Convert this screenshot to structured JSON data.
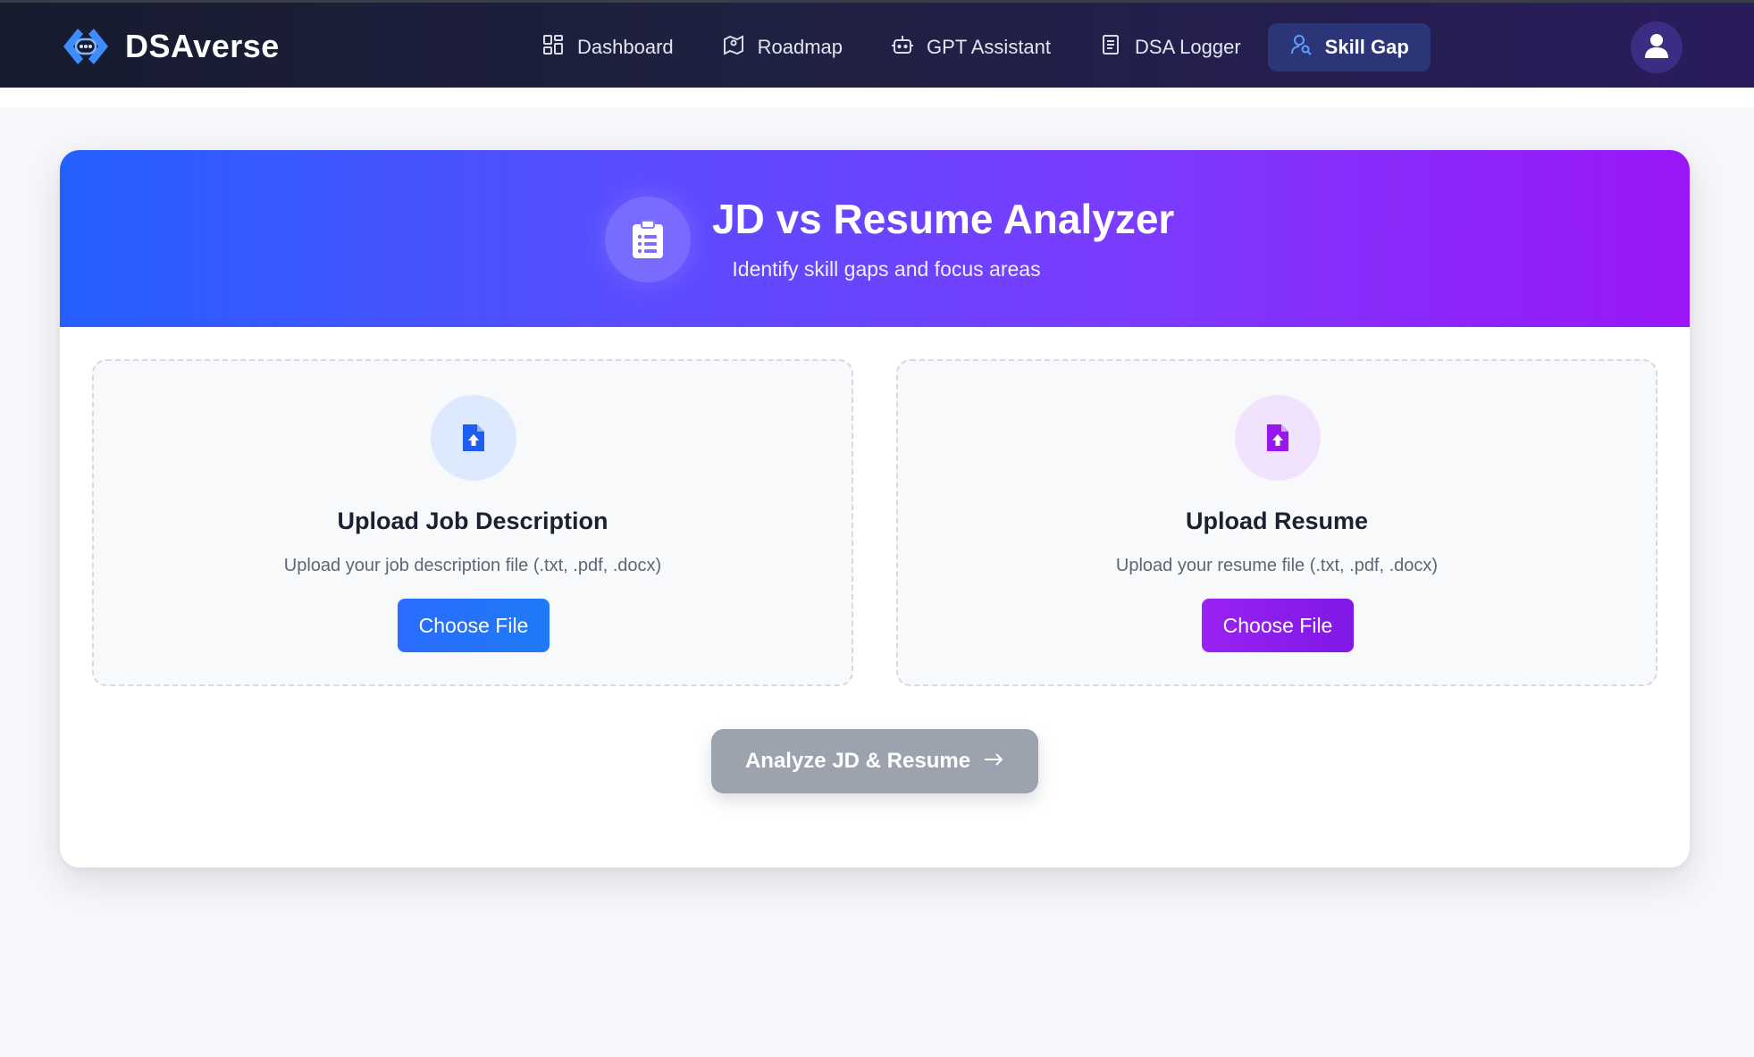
{
  "brand": {
    "name": "DSAverse"
  },
  "nav": {
    "items": [
      {
        "label": "Dashboard",
        "icon": "dashboard-icon"
      },
      {
        "label": "Roadmap",
        "icon": "map-icon"
      },
      {
        "label": "GPT Assistant",
        "icon": "robot-icon"
      },
      {
        "label": "DSA Logger",
        "icon": "document-icon"
      },
      {
        "label": "Skill Gap",
        "icon": "user-search-icon",
        "active": true
      }
    ]
  },
  "hero": {
    "title": "JD vs Resume Analyzer",
    "subtitle": "Identify skill gaps and focus areas",
    "icon": "clipboard-list-icon"
  },
  "uploads": {
    "jd": {
      "title": "Upload Job Description",
      "description": "Upload your job description file (.txt, .pdf, .docx)",
      "button": "Choose File",
      "icon": "file-upload-icon",
      "accent": "#1f63f2"
    },
    "resume": {
      "title": "Upload Resume",
      "description": "Upload your resume file (.txt, .pdf, .docx)",
      "button": "Choose File",
      "icon": "file-upload-icon",
      "accent": "#9a16f0"
    }
  },
  "actions": {
    "analyze": "Analyze JD & Resume"
  },
  "colors": {
    "nav_bg_start": "#171b2e",
    "nav_bg_end": "#2a1c5c",
    "hero_start": "#2460ff",
    "hero_end": "#9a16f7",
    "analyze_disabled": "#9ca3af"
  }
}
